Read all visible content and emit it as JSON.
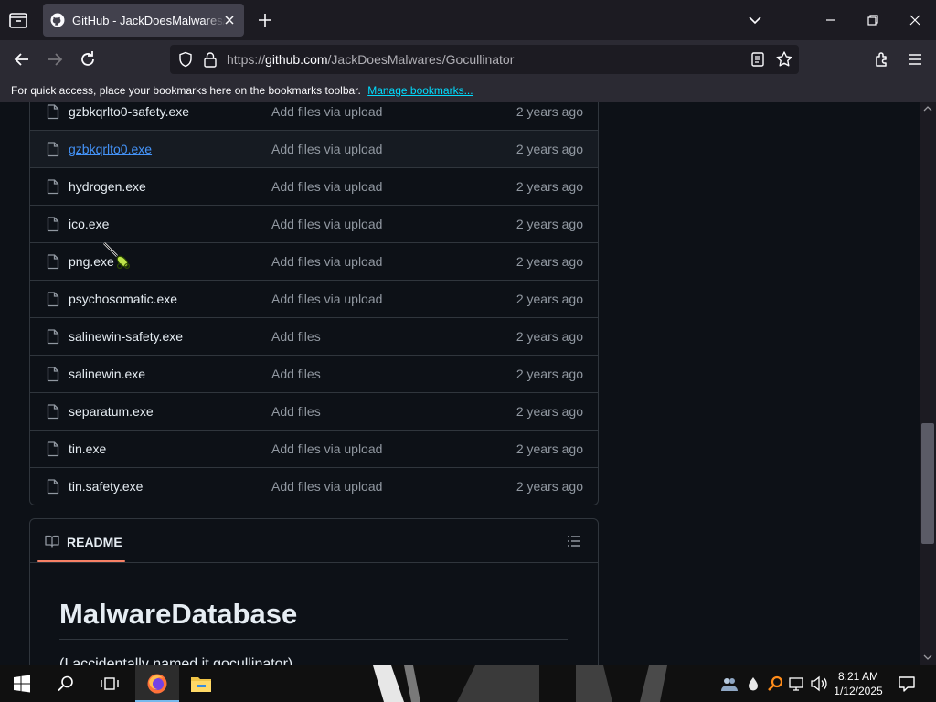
{
  "browser": {
    "tab_title": "GitHub - JackDoesMalwares/Gocullinator",
    "url_prefix": "https://",
    "url_host": "github.com",
    "url_path": "/JackDoesMalwares/Gocullinator",
    "bookmarks_hint": "For quick access, place your bookmarks here on the bookmarks toolbar.",
    "manage_bookmarks": "Manage bookmarks..."
  },
  "files": [
    {
      "name": "gzbkqrlto0-safety.exe",
      "message": "Add files via upload",
      "age": "2 years ago"
    },
    {
      "name": "gzbkqrlto0.exe",
      "message": "Add files via upload",
      "age": "2 years ago"
    },
    {
      "name": "hydrogen.exe",
      "message": "Add files via upload",
      "age": "2 years ago"
    },
    {
      "name": "ico.exe",
      "message": "Add files via upload",
      "age": "2 years ago"
    },
    {
      "name": "png.exe",
      "message": "Add files via upload",
      "age": "2 years ago"
    },
    {
      "name": "psychosomatic.exe",
      "message": "Add files via upload",
      "age": "2 years ago"
    },
    {
      "name": "salinewin-safety.exe",
      "message": "Add files",
      "age": "2 years ago"
    },
    {
      "name": "salinewin.exe",
      "message": "Add files",
      "age": "2 years ago"
    },
    {
      "name": "separatum.exe",
      "message": "Add files",
      "age": "2 years ago"
    },
    {
      "name": "tin.exe",
      "message": "Add files via upload",
      "age": "2 years ago"
    },
    {
      "name": "tin.safety.exe",
      "message": "Add files via upload",
      "age": "2 years ago"
    }
  ],
  "readme": {
    "tab_label": "README",
    "heading": "MalwareDatabase",
    "paragraph": "(I accidentally named it gocullinator)"
  },
  "taskbar": {
    "time": "8:21 AM",
    "date": "1/12/2025"
  },
  "colors": {
    "page_bg": "#0d1117",
    "link": "#4493f8",
    "readme_accent": "#f78166",
    "muted_text": "#9198a1"
  }
}
